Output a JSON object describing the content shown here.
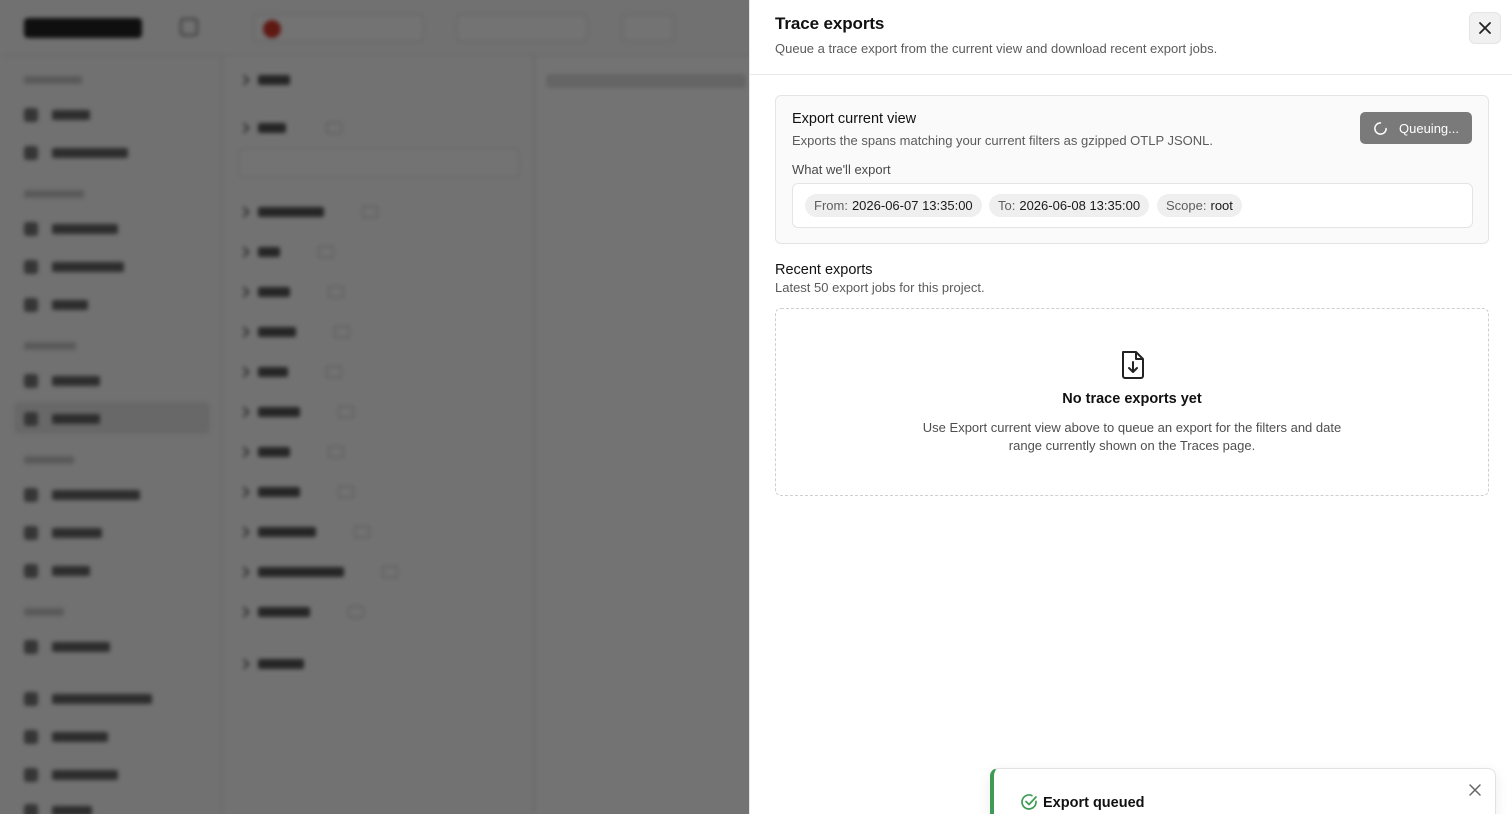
{
  "drawer": {
    "title": "Trace exports",
    "subtitle": "Queue a trace export from the current view and download recent export jobs."
  },
  "export_card": {
    "title": "Export current view",
    "description": "Exports the spans matching your current filters as gzipped OTLP JSONL.",
    "button_label": "Queuing...",
    "section_label": "What we'll export",
    "chips": [
      {
        "key": "From:",
        "value": "2026-06-07 13:35:00"
      },
      {
        "key": "To:",
        "value": "2026-06-08 13:35:00"
      },
      {
        "key": "Scope:",
        "value": "root"
      }
    ]
  },
  "recent": {
    "title": "Recent exports",
    "subtitle": "Latest 50 export jobs for this project.",
    "empty_title": "No trace exports yet",
    "empty_description": "Use Export current view above to queue an export for the filters and date range currently shown on the Traces page."
  },
  "toast": {
    "title": "Export queued",
    "accent": "#3f9b54"
  },
  "icons": {
    "close": "close-icon",
    "spinner": "spinner-icon",
    "file_download": "file-download-icon",
    "check_circle": "check-circle-icon"
  }
}
